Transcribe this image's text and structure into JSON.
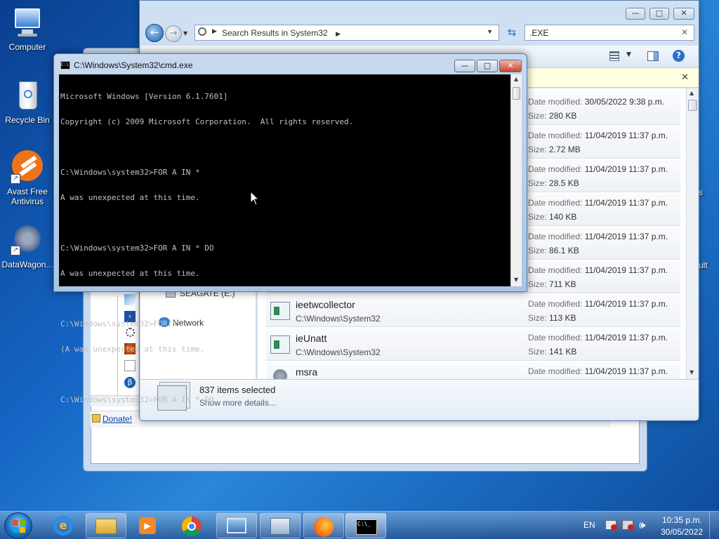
{
  "desktop": {
    "icons": [
      {
        "label": "Computer"
      },
      {
        "label": "Recycle Bin"
      },
      {
        "label": "Avast Free Antivirus"
      },
      {
        "label": "DataWagon..."
      }
    ],
    "right_partial": [
      "s",
      "ult"
    ]
  },
  "background_window": {
    "donate_link": "Donate!",
    "nav_partial": "SEAGATE (E:)"
  },
  "explorer": {
    "breadcrumb": "Search Results in System32",
    "search_value": ".EXE",
    "network_label": "Network",
    "rows": [
      {
        "name": "",
        "path": "",
        "date_label": "Date modified:",
        "date": "30/05/2022 9:38 p.m.",
        "size_label": "Size:",
        "size": "280 KB"
      },
      {
        "name": "",
        "path": "",
        "date_label": "Date modified:",
        "date": "11/04/2019 11:37 p.m.",
        "size_label": "Size:",
        "size": "2.72 MB"
      },
      {
        "name": "",
        "path": "",
        "date_label": "Date modified:",
        "date": "11/04/2019 11:37 p.m.",
        "size_label": "Size:",
        "size": "28.5 KB"
      },
      {
        "name": "",
        "path": "",
        "date_label": "Date modified:",
        "date": "11/04/2019 11:37 p.m.",
        "size_label": "Size:",
        "size": "140 KB"
      },
      {
        "name": "",
        "path": "",
        "date_label": "Date modified:",
        "date": "11/04/2019 11:37 p.m.",
        "size_label": "Size:",
        "size": "86.1 KB"
      },
      {
        "name": "",
        "path": "",
        "date_label": "Date modified:",
        "date": "11/04/2019 11:37 p.m.",
        "size_label": "Size:",
        "size": "711 KB"
      },
      {
        "name": "ieetwcollector",
        "path": "C:\\Windows\\System32",
        "date_label": "Date modified:",
        "date": "11/04/2019 11:37 p.m.",
        "size_label": "Size:",
        "size": "113 KB"
      },
      {
        "name": "ieUnatt",
        "path": "C:\\Windows\\System32",
        "date_label": "Date modified:",
        "date": "11/04/2019 11:37 p.m.",
        "size_label": "Size:",
        "size": "141 KB"
      },
      {
        "name": "msra",
        "path": "",
        "date_label": "Date modified:",
        "date": "11/04/2019 11:37 p.m.",
        "size_label": "",
        "size": ""
      }
    ],
    "details": {
      "selected": "837 items selected",
      "more": "Show more details..."
    }
  },
  "cmd": {
    "title": "C:\\Windows\\System32\\cmd.exe",
    "lines": [
      "Microsoft Windows [Version 6.1.7601]",
      "Copyright (c) 2009 Microsoft Corporation.  All rights reserved.",
      "",
      "C:\\Windows\\system32>FOR A IN *",
      "A was unexpected at this time.",
      "",
      "C:\\Windows\\system32>FOR A IN * DO",
      "A was unexpected at this time.",
      "",
      "C:\\Windows\\system32>FOR(A",
      "(A was unexpected at this time.",
      "",
      "C:\\Windows\\system32>FOR A IN * DO"
    ]
  },
  "taskbar": {
    "language": "EN",
    "time": "10:35 p.m.",
    "date": "30/05/2022"
  }
}
